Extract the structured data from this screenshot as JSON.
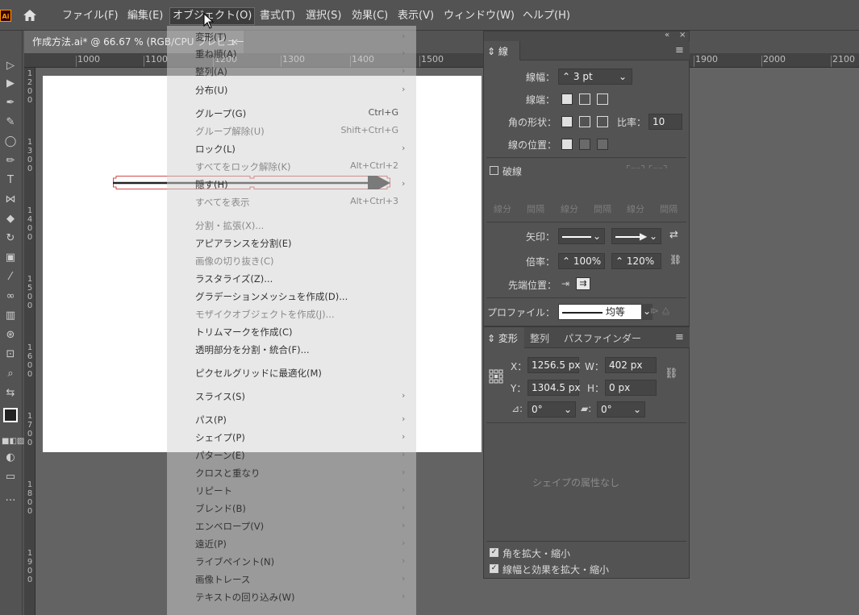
{
  "app": {
    "logo_text": "Ai"
  },
  "menubar": {
    "items": [
      "ファイル(F)",
      "編集(E)",
      "オブジェクト(O)",
      "書式(T)",
      "選択(S)",
      "効果(C)",
      "表示(V)",
      "ウィンドウ(W)",
      "ヘルプ(H)"
    ],
    "active_index": 2
  },
  "document_tab": {
    "title": "作成方法.ai* @ 66.67 % (RGB/CPU プレビュー)",
    "close": "×"
  },
  "ruler_top": [
    "1000",
    "1100",
    "1200",
    "1300",
    "1400",
    "1500",
    "1900",
    "2000",
    "2100"
  ],
  "ruler_left": [
    [
      "1",
      "2",
      "0",
      "0"
    ],
    [
      "1",
      "3",
      "0",
      "0"
    ],
    [
      "1",
      "4",
      "0",
      "0"
    ],
    [
      "1",
      "5",
      "0",
      "0"
    ],
    [
      "1",
      "6",
      "0",
      "0"
    ],
    [
      "1",
      "7",
      "0",
      "0"
    ],
    [
      "1",
      "8",
      "0",
      "0"
    ],
    [
      "1",
      "9",
      "0",
      "0"
    ]
  ],
  "object_menu": {
    "items": [
      {
        "label": "変形(T)",
        "shortcut": "",
        "arrow": "›",
        "enabled": true
      },
      {
        "label": "重ね順(A)",
        "shortcut": "",
        "arrow": "›",
        "enabled": true
      },
      {
        "label": "整列(A)",
        "shortcut": "",
        "arrow": "›",
        "enabled": true
      },
      {
        "label": "分布(U)",
        "shortcut": "",
        "arrow": "›",
        "enabled": true
      },
      {
        "label": "グループ(G)",
        "shortcut": "Ctrl+G",
        "arrow": "",
        "enabled": true
      },
      {
        "label": "グループ解除(U)",
        "shortcut": "Shift+Ctrl+G",
        "arrow": "",
        "enabled": false
      },
      {
        "label": "ロック(L)",
        "shortcut": "",
        "arrow": "›",
        "enabled": true
      },
      {
        "label": "すべてをロック解除(K)",
        "shortcut": "Alt+Ctrl+2",
        "arrow": "",
        "enabled": false
      },
      {
        "label": "隠す(H)",
        "shortcut": "",
        "arrow": "›",
        "enabled": true
      },
      {
        "label": "すべてを表示",
        "shortcut": "Alt+Ctrl+3",
        "arrow": "",
        "enabled": false
      },
      {
        "label": "分割・拡張(X)...",
        "shortcut": "",
        "arrow": "",
        "enabled": false
      },
      {
        "label": "アピアランスを分割(E)",
        "shortcut": "",
        "arrow": "",
        "enabled": true
      },
      {
        "label": "画像の切り抜き(C)",
        "shortcut": "",
        "arrow": "",
        "enabled": false
      },
      {
        "label": "ラスタライズ(Z)...",
        "shortcut": "",
        "arrow": "",
        "enabled": true
      },
      {
        "label": "グラデーションメッシュを作成(D)...",
        "shortcut": "",
        "arrow": "",
        "enabled": true
      },
      {
        "label": "モザイクオブジェクトを作成(J)...",
        "shortcut": "",
        "arrow": "",
        "enabled": false
      },
      {
        "label": "トリムマークを作成(C)",
        "shortcut": "",
        "arrow": "",
        "enabled": true
      },
      {
        "label": "透明部分を分割・統合(F)...",
        "shortcut": "",
        "arrow": "",
        "enabled": true
      },
      {
        "label": "ピクセルグリッドに最適化(M)",
        "shortcut": "",
        "arrow": "",
        "enabled": true
      },
      {
        "label": "スライス(S)",
        "shortcut": "",
        "arrow": "›",
        "enabled": true
      },
      {
        "label": "パス(P)",
        "shortcut": "",
        "arrow": "›",
        "enabled": true
      },
      {
        "label": "シェイプ(P)",
        "shortcut": "",
        "arrow": "›",
        "enabled": true
      },
      {
        "label": "パターン(E)",
        "shortcut": "",
        "arrow": "›",
        "enabled": true
      },
      {
        "label": "クロスと重なり",
        "shortcut": "",
        "arrow": "›",
        "enabled": true
      },
      {
        "label": "リピート",
        "shortcut": "",
        "arrow": "›",
        "enabled": true
      },
      {
        "label": "ブレンド(B)",
        "shortcut": "",
        "arrow": "›",
        "enabled": true
      },
      {
        "label": "エンベロープ(V)",
        "shortcut": "",
        "arrow": "›",
        "enabled": true
      },
      {
        "label": "遠近(P)",
        "shortcut": "",
        "arrow": "›",
        "enabled": true
      },
      {
        "label": "ライブペイント(N)",
        "shortcut": "",
        "arrow": "›",
        "enabled": true
      },
      {
        "label": "画像トレース",
        "shortcut": "",
        "arrow": "›",
        "enabled": true
      },
      {
        "label": "テキストの回り込み(W)",
        "shortcut": "",
        "arrow": "›",
        "enabled": true
      }
    ]
  },
  "stroke_panel": {
    "tab": "線",
    "collapse": "«",
    "close": "×",
    "weight_label": "線幅：",
    "weight_value": "3 pt",
    "cap_label": "線端：",
    "corner_label": "角の形状：",
    "limit_label": "比率：",
    "limit_value": "10",
    "align_label": "線の位置：",
    "dashed_label": "破線",
    "dash_fields": [
      "線分",
      "間隔",
      "線分",
      "間隔",
      "線分",
      "間隔"
    ],
    "arrow_label": "矢印：",
    "scale_label": "倍率：",
    "scale_start": "100%",
    "scale_end": "120%",
    "tip_label": "先端位置：",
    "profile_label": "プロファイル：",
    "profile_value": "均等"
  },
  "transform_panel": {
    "tabs": [
      "変形",
      "整列",
      "パスファインダー"
    ],
    "active_tab": 0,
    "x_label": "X：",
    "x_value": "1256.5 px",
    "y_label": "Y：",
    "y_value": "1304.5 px",
    "w_label": "W：",
    "w_value": "402 px",
    "h_label": "H：",
    "h_value": "0 px",
    "rotate_value": "0°",
    "shear_value": "0°",
    "no_shape_text": "シェイプの属性なし",
    "scale_corners_label": "角を拡大・縮小",
    "scale_corners_checked": true,
    "scale_strokes_label": "線幅と効果を拡大・縮小",
    "scale_strokes_checked": true
  }
}
